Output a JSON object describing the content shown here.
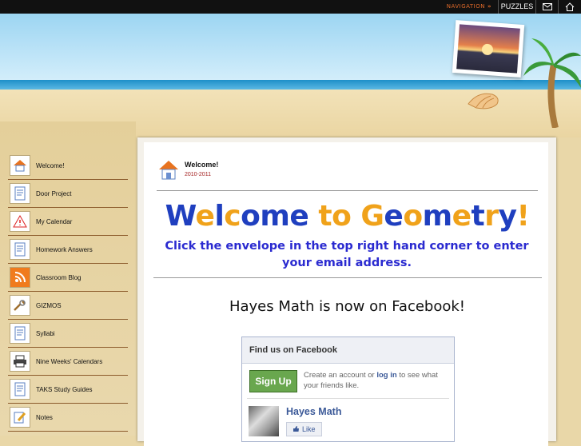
{
  "topbar": {
    "navigation_label": "NAVIGATION",
    "navigation_arrow": "»",
    "puzzles_label": "PUZZLES",
    "envelope_icon": "envelope-icon",
    "home_icon": "home-icon"
  },
  "sidebar": {
    "items": [
      {
        "label": "Welcome!",
        "icon": "house-icon"
      },
      {
        "label": "Door Project",
        "icon": "document-icon"
      },
      {
        "label": "My Calendar",
        "icon": "warning-icon"
      },
      {
        "label": "Homework Answers",
        "icon": "document-icon"
      },
      {
        "label": "Classroom Blog",
        "icon": "rss-icon"
      },
      {
        "label": "GIZMOS",
        "icon": "tools-icon"
      },
      {
        "label": "Syllabi",
        "icon": "document-icon"
      },
      {
        "label": "Nine Weeks' Calendars",
        "icon": "printer-icon"
      },
      {
        "label": "TAKS Study Guides",
        "icon": "document-icon"
      },
      {
        "label": "Notes",
        "icon": "pencil-icon"
      }
    ]
  },
  "main": {
    "welcome_title": "Welcome!",
    "welcome_date": "2010-2011",
    "headline_letters": [
      {
        "ch": "W",
        "color": "#1f3fbf"
      },
      {
        "ch": "e",
        "color": "#f0a21a"
      },
      {
        "ch": "l",
        "color": "#1f3fbf"
      },
      {
        "ch": "c",
        "color": "#f0a21a"
      },
      {
        "ch": "o",
        "color": "#1f3fbf"
      },
      {
        "ch": "m",
        "color": "#1f3fbf"
      },
      {
        "ch": "e",
        "color": "#1f3fbf"
      },
      {
        "ch": " ",
        "color": "#1f3fbf"
      },
      {
        "ch": "t",
        "color": "#f0a21a"
      },
      {
        "ch": "o",
        "color": "#f0a21a"
      },
      {
        "ch": " ",
        "color": "#1f3fbf"
      },
      {
        "ch": "G",
        "color": "#f0a21a"
      },
      {
        "ch": "e",
        "color": "#1f3fbf"
      },
      {
        "ch": "o",
        "color": "#f0a21a"
      },
      {
        "ch": "m",
        "color": "#1f3fbf"
      },
      {
        "ch": "e",
        "color": "#f0a21a"
      },
      {
        "ch": "t",
        "color": "#1f3fbf"
      },
      {
        "ch": "r",
        "color": "#f0a21a"
      },
      {
        "ch": "y",
        "color": "#1f3fbf"
      },
      {
        "ch": "!",
        "color": "#f0a21a"
      }
    ],
    "subline": "Click the envelope in the top right hand corner to enter your email address.",
    "facebook_line": "Hayes Math is now on Facebook!"
  },
  "facebook": {
    "header": "Find us on Facebook",
    "signup_label": "Sign Up",
    "text_before": "Create an account or ",
    "login_link": "log in",
    "text_after": " to see what your friends like.",
    "page_name": "Hayes Math",
    "like_label": "Like"
  },
  "colors": {
    "topbar": "#111111",
    "sidebar_divider": "#8b5a2b",
    "subline": "#2a2ad0",
    "facebook_link": "#3b5998",
    "signup": "#69a74e"
  }
}
